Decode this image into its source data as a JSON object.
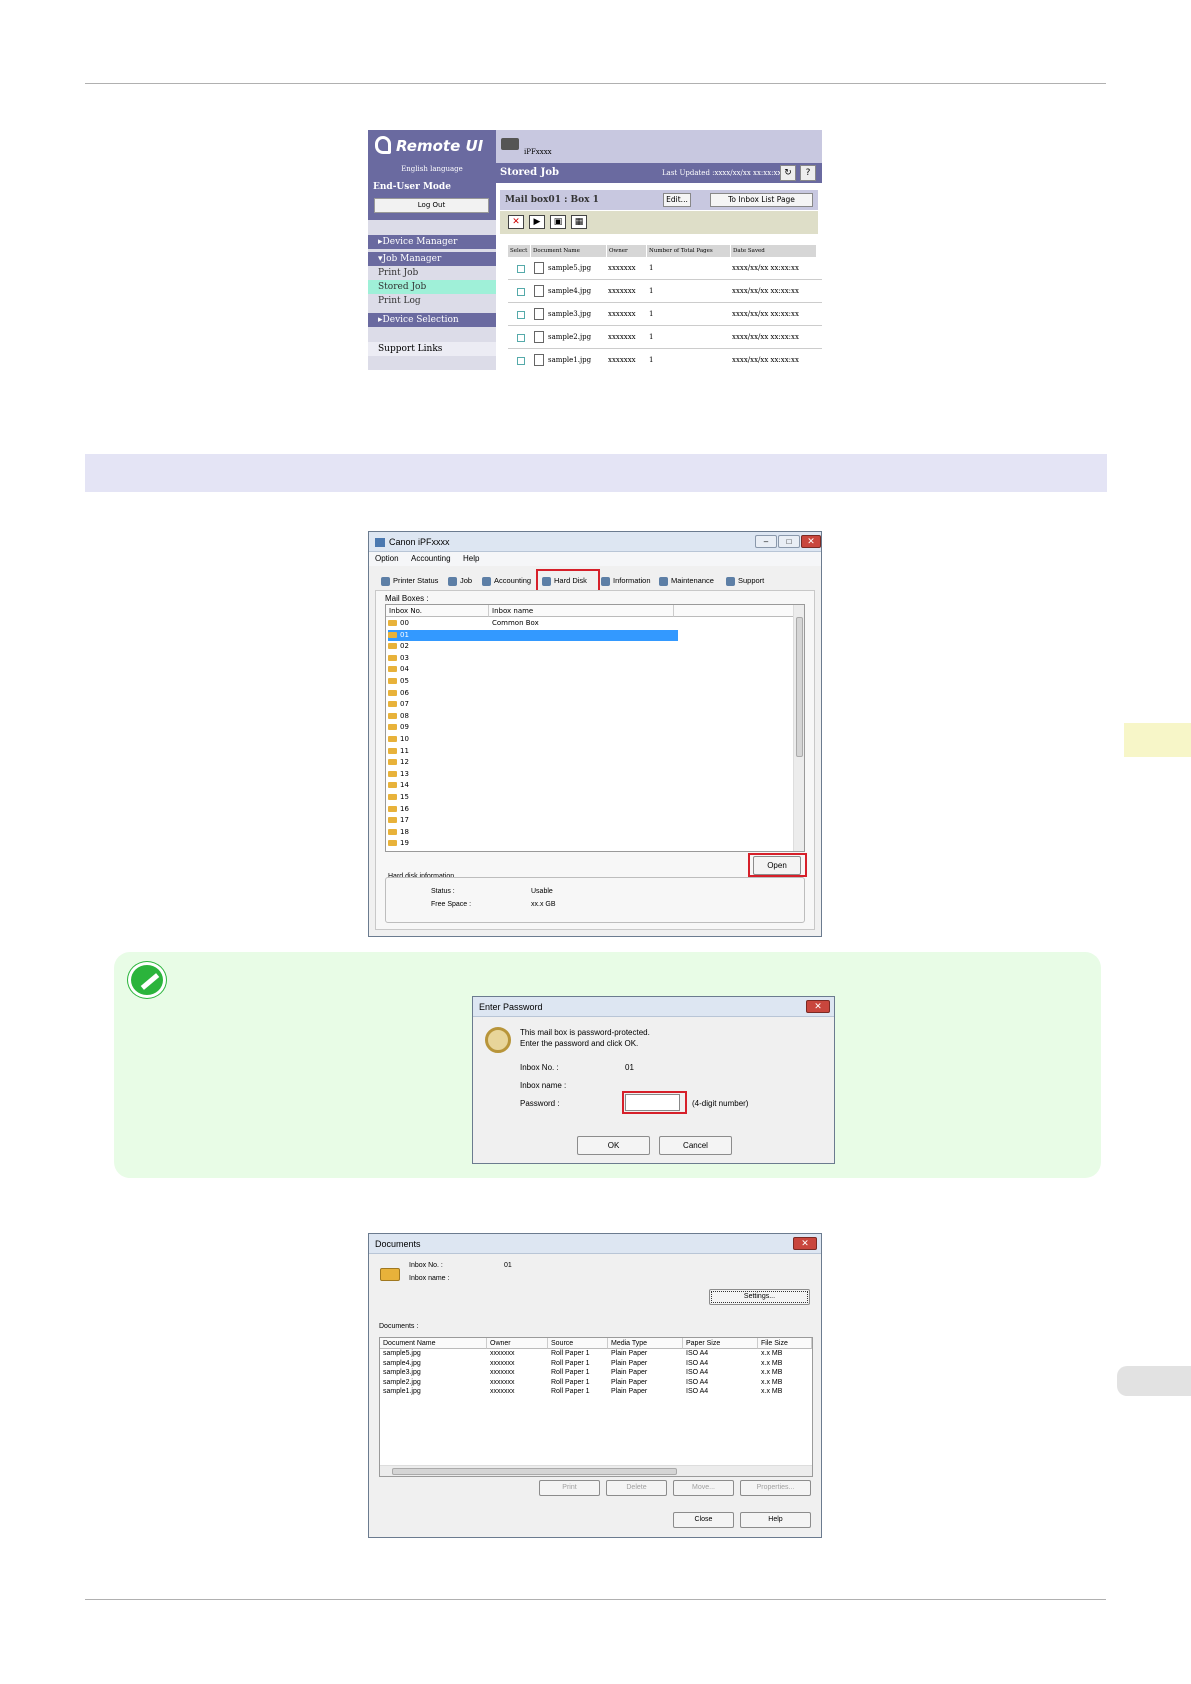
{
  "remote_ui": {
    "logo": "Remote UI",
    "language": "English language",
    "mode": "End-User Mode",
    "logout": "Log Out",
    "menu": {
      "device_manager": "Device Manager",
      "job_manager": "Job Manager",
      "print_job": "Print Job",
      "stored_job": "Stored Job",
      "print_log": "Print Log",
      "device_selection": "Device Selection",
      "support_links": "Support Links"
    },
    "printer_name": "iPFxxxx",
    "bar_title": "Stored Job",
    "last_updated": "Last Updated :xxxx/xx/xx xx:xx:xx",
    "box_title": "Mail box01 : Box 1",
    "edit_button": "Edit...",
    "to_inbox_button": "To Inbox List Page",
    "columns": [
      "Select",
      "Document Name",
      "Owner",
      "Number of Total Pages",
      "Date Saved"
    ],
    "rows": [
      {
        "name": "sample5.jpg",
        "owner": "xxxxxxx",
        "pages": "1",
        "date": "xxxx/xx/xx xx:xx:xx"
      },
      {
        "name": "sample4.jpg",
        "owner": "xxxxxxx",
        "pages": "1",
        "date": "xxxx/xx/xx xx:xx:xx"
      },
      {
        "name": "sample3.jpg",
        "owner": "xxxxxxx",
        "pages": "1",
        "date": "xxxx/xx/xx xx:xx:xx"
      },
      {
        "name": "sample2.jpg",
        "owner": "xxxxxxx",
        "pages": "1",
        "date": "xxxx/xx/xx xx:xx:xx"
      },
      {
        "name": "sample1.jpg",
        "owner": "xxxxxxx",
        "pages": "1",
        "date": "xxxx/xx/xx xx:xx:xx"
      }
    ]
  },
  "canon_window": {
    "title": "Canon iPFxxxx",
    "menu": [
      "Option",
      "Accounting",
      "Help"
    ],
    "tabs": [
      "Printer Status",
      "Job",
      "Accounting",
      "Hard Disk",
      "Information",
      "Maintenance",
      "Support"
    ],
    "mail_boxes_label": "Mail Boxes :",
    "col_inbox_no": "Inbox No.",
    "col_inbox_name": "Inbox name",
    "inboxes": [
      "00",
      "01",
      "02",
      "03",
      "04",
      "05",
      "06",
      "07",
      "08",
      "09",
      "10",
      "11",
      "12",
      "13",
      "14",
      "15",
      "16",
      "17",
      "18",
      "19"
    ],
    "common_box": "Common Box",
    "open_button": "Open",
    "hd_info_label": "Hard disk information",
    "status_label": "Status :",
    "status_value": "Usable",
    "free_space_label": "Free Space :",
    "free_space_value": "xx.x GB"
  },
  "password_dialog": {
    "title": "Enter Password",
    "message1": "This mail box is password-protected.",
    "message2": "Enter the password and click OK.",
    "inbox_no_label": "Inbox No. :",
    "inbox_no_value": "01",
    "inbox_name_label": "Inbox name :",
    "password_label": "Password :",
    "password_hint": "(4-digit number)",
    "ok": "OK",
    "cancel": "Cancel"
  },
  "documents_dialog": {
    "title": "Documents",
    "inbox_no_label": "Inbox No. :",
    "inbox_no_value": "01",
    "inbox_name_label": "Inbox name :",
    "settings_button": "Settings...",
    "documents_label": "Documents :",
    "columns": [
      "Document Name",
      "Owner",
      "Source",
      "Media Type",
      "Paper Size",
      "File Size"
    ],
    "rows": [
      [
        "sample5.jpg",
        "xxxxxxx",
        "Roll Paper 1",
        "Plain Paper",
        "ISO A4",
        "x.x MB"
      ],
      [
        "sample4.jpg",
        "xxxxxxx",
        "Roll Paper 1",
        "Plain Paper",
        "ISO A4",
        "x.x MB"
      ],
      [
        "sample3.jpg",
        "xxxxxxx",
        "Roll Paper 1",
        "Plain Paper",
        "ISO A4",
        "x.x MB"
      ],
      [
        "sample2.jpg",
        "xxxxxxx",
        "Roll Paper 1",
        "Plain Paper",
        "ISO A4",
        "x.x MB"
      ],
      [
        "sample1.jpg",
        "xxxxxxx",
        "Roll Paper 1",
        "Plain Paper",
        "ISO A4",
        "x.x MB"
      ]
    ],
    "print_button": "Print",
    "delete_button": "Delete",
    "move_button": "Move...",
    "properties_button": "Properties...",
    "close_button": "Close",
    "help_button": "Help"
  }
}
